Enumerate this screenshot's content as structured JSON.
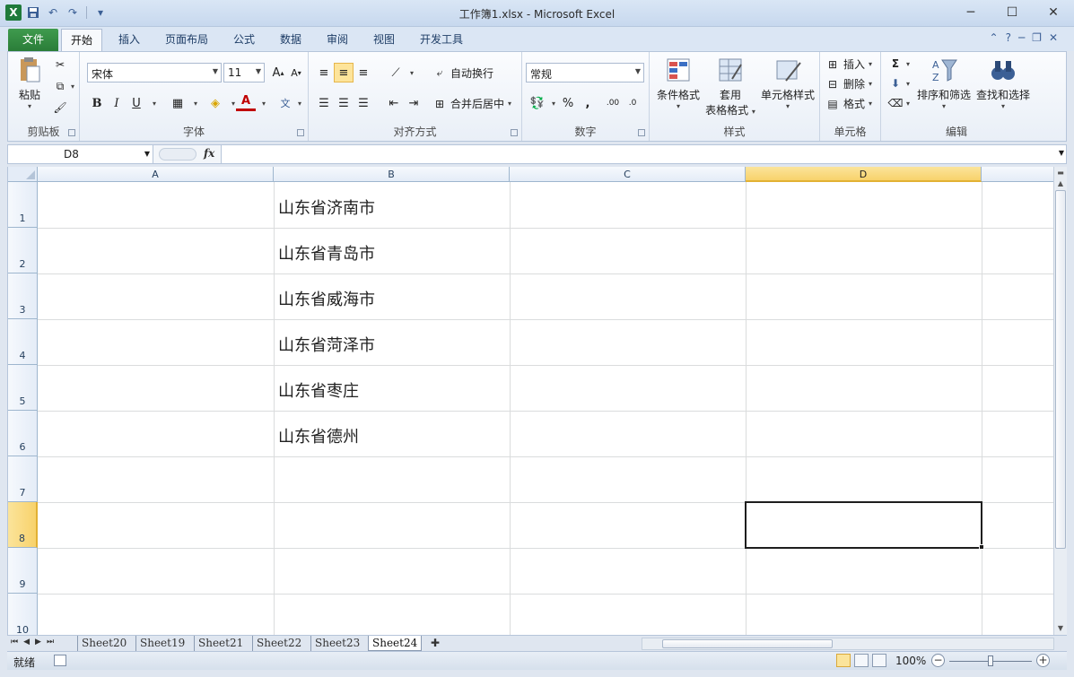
{
  "window": {
    "title": "工作簿1.xlsx - Microsoft Excel"
  },
  "ribbon_tabs": [
    {
      "label": "文件"
    },
    {
      "label": "开始"
    },
    {
      "label": "插入"
    },
    {
      "label": "页面布局"
    },
    {
      "label": "公式"
    },
    {
      "label": "数据"
    },
    {
      "label": "审阅"
    },
    {
      "label": "视图"
    },
    {
      "label": "开发工具"
    }
  ],
  "ribbon": {
    "clipboard": {
      "label": "剪贴板",
      "paste": "粘贴"
    },
    "font": {
      "label": "字体",
      "name": "宋体",
      "size": "11"
    },
    "alignment": {
      "label": "对齐方式",
      "wrap": "自动换行",
      "merge": "合并后居中"
    },
    "number": {
      "label": "数字",
      "format": "常规"
    },
    "styles": {
      "label": "样式",
      "conditional": "条件格式",
      "table_line1": "套用",
      "table_line2": "表格格式",
      "cell_styles": "单元格样式"
    },
    "cells": {
      "label": "单元格",
      "insert": "插入",
      "delete": "删除",
      "format": "格式"
    },
    "editing": {
      "label": "编辑",
      "sort": "排序和筛选",
      "find": "查找和选择"
    }
  },
  "formula_bar": {
    "name_box": "D8",
    "fx": "fx",
    "formula": ""
  },
  "sheet": {
    "columns": [
      "A",
      "B",
      "C",
      "D"
    ],
    "selected_column": "D",
    "rows": [
      "1",
      "2",
      "3",
      "4",
      "5",
      "6",
      "7",
      "8",
      "9",
      "10"
    ],
    "selected_row": "8",
    "cells_B": [
      "山东省济南市",
      "山东省青岛市",
      "山东省威海市",
      "山东省菏泽市",
      "山东省枣庄",
      "山东省德州"
    ],
    "active_cell": "D8"
  },
  "sheet_tabs": [
    "Sheet20",
    "Sheet19",
    "Sheet21",
    "Sheet22",
    "Sheet23",
    "Sheet24"
  ],
  "active_sheet": "Sheet24",
  "status_bar": {
    "status": "就绪",
    "zoom": "100%"
  },
  "colors": {
    "selection_header": "#f8d26b",
    "file_tab": "#2a7d38",
    "title_bar": "#c7d8ee"
  }
}
